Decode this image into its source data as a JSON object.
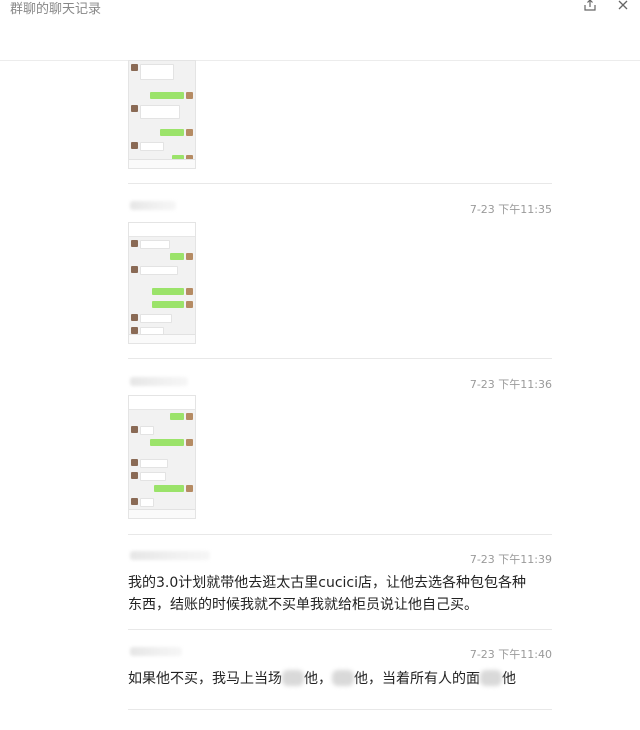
{
  "window": {
    "title": "群聊的聊天记录",
    "share_icon": "share-icon",
    "close_icon": "close-icon"
  },
  "messages": [
    {
      "type": "image",
      "time": ""
    },
    {
      "type": "image",
      "time": "7-23 下午11:35"
    },
    {
      "type": "image",
      "time": "7-23 下午11:36"
    },
    {
      "type": "text",
      "time": "7-23 下午11:39",
      "line1": "我的3.0计划就带他去逛太古里cucici店，让他去选各种包包各种",
      "line2": "东西，结账的时候我就不买单我就给柜员说让他自己买。"
    },
    {
      "type": "text",
      "time": "7-23 下午11:40",
      "part1": "如果他不买，我马上当场",
      "part2": "他，",
      "part3": "他，当着所有人的面",
      "part4": "他"
    }
  ],
  "colors": {
    "bubble_self": "#9be36a",
    "time_text": "#9a9a9a",
    "title_text": "#888888"
  }
}
